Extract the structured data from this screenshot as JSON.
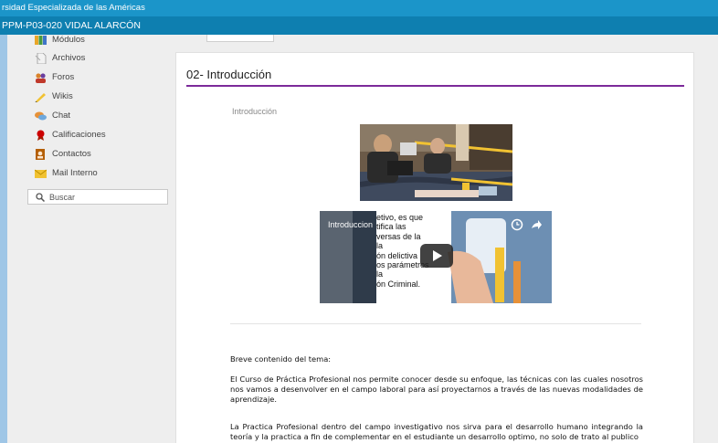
{
  "header": {
    "institution": "rsidad Especializada de las Américas",
    "course": "PPM-P03-020 VIDAL ALARCÓN"
  },
  "sidebar": {
    "items": [
      {
        "label": "Módulos",
        "icon": "modules-icon"
      },
      {
        "label": "Archivos",
        "icon": "files-icon"
      },
      {
        "label": "Foros",
        "icon": "forums-icon"
      },
      {
        "label": "Wikis",
        "icon": "wiki-icon"
      },
      {
        "label": "Chat",
        "icon": "chat-icon"
      },
      {
        "label": "Calificaciones",
        "icon": "grades-icon"
      },
      {
        "label": "Contactos",
        "icon": "contacts-icon"
      },
      {
        "label": "Mail Interno",
        "icon": "mail-icon"
      }
    ],
    "search_label": "Buscar"
  },
  "main": {
    "title": "02- Introducción",
    "section_label": "Introducción",
    "video": {
      "title": "Introduccion",
      "overlay_text": "etivo, es que\ntifica las\nversas de la\nla\nón delictiva\nos parámetros\nla\nón Criminal."
    },
    "subtitle": "Breve contenido del tema:",
    "paragraph1": "El Curso de Práctica Profesional nos permite conocer desde su enfoque, las técnicas con las cuales nosotros nos vamos a desenvolver en el campo laboral para así proyectarnos a través de las nuevas modalidades de aprendizaje.",
    "paragraph2": "La Practica Profesional dentro del campo investigativo nos sirva para el desarrollo humano integrando la teoría y la practica a fin de complementar en el estudiante un desarrollo optimo, no solo de trato al publico"
  },
  "colors": {
    "topbar": "#1b95c9",
    "coursebar": "#0e7fb0",
    "title_rule": "#7c2a9a"
  }
}
